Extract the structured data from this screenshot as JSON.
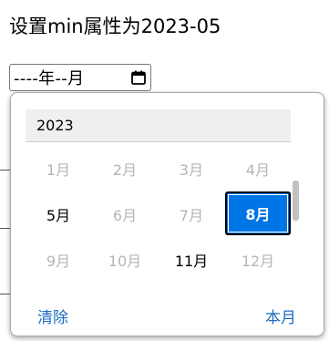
{
  "page": {
    "title": "设置min属性为2023-05"
  },
  "month_input": {
    "display_value": "----年--月",
    "icon": "calendar-icon"
  },
  "picker": {
    "year": "2023",
    "months": [
      {
        "label": "1月",
        "state": "disabled"
      },
      {
        "label": "2月",
        "state": "disabled"
      },
      {
        "label": "3月",
        "state": "disabled"
      },
      {
        "label": "4月",
        "state": "disabled"
      },
      {
        "label": "5月",
        "state": "enabled"
      },
      {
        "label": "6月",
        "state": "disabled"
      },
      {
        "label": "7月",
        "state": "disabled"
      },
      {
        "label": "8月",
        "state": "selected"
      },
      {
        "label": "9月",
        "state": "disabled"
      },
      {
        "label": "10月",
        "state": "disabled"
      },
      {
        "label": "11月",
        "state": "enabled"
      },
      {
        "label": "12月",
        "state": "disabled"
      }
    ],
    "clear_label": "清除",
    "this_month_label": "本月"
  },
  "colors": {
    "selected_bg": "#0075e6",
    "link": "#1a6ec2",
    "disabled_text": "#b5b5b5"
  }
}
